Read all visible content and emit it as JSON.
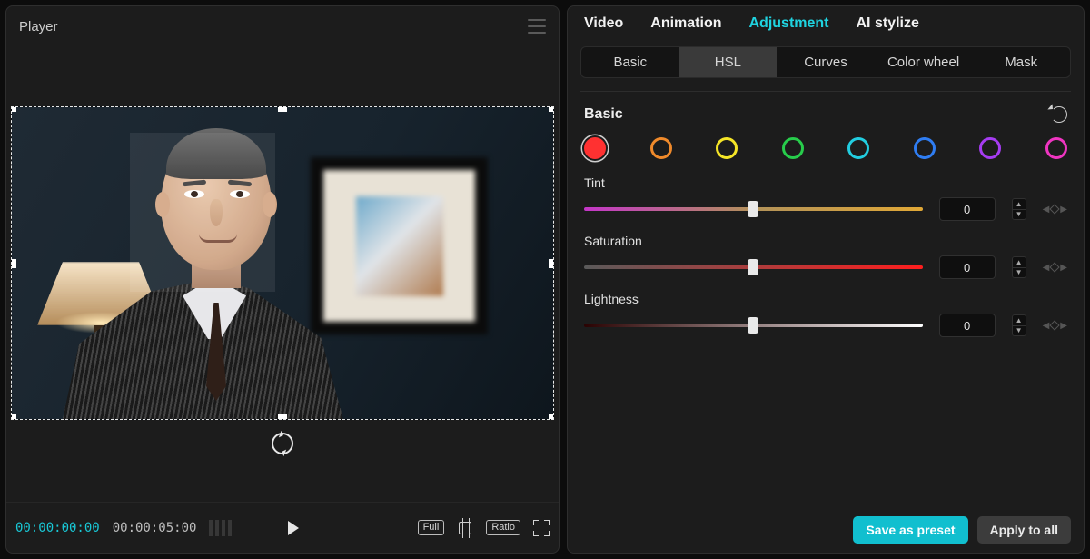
{
  "player": {
    "title": "Player",
    "current_tc": "00:00:00:00",
    "duration_tc": "00:00:05:00",
    "badges": {
      "full": "Full",
      "ratio": "Ratio"
    }
  },
  "inspector": {
    "tabs": [
      {
        "id": "video",
        "label": "Video",
        "active": false
      },
      {
        "id": "animation",
        "label": "Animation",
        "active": false
      },
      {
        "id": "adjustment",
        "label": "Adjustment",
        "active": true
      },
      {
        "id": "ai-stylize",
        "label": "AI stylize",
        "active": false
      }
    ],
    "subtabs": [
      {
        "id": "basic",
        "label": "Basic",
        "active": false
      },
      {
        "id": "hsl",
        "label": "HSL",
        "active": true
      },
      {
        "id": "curves",
        "label": "Curves",
        "active": false
      },
      {
        "id": "color-wheel",
        "label": "Color wheel",
        "active": false
      },
      {
        "id": "mask",
        "label": "Mask",
        "active": false
      }
    ],
    "section_title": "Basic",
    "swatches": [
      {
        "name": "red",
        "color": "#ff3131",
        "selected": true,
        "filled": true
      },
      {
        "name": "orange",
        "color": "#f08a2b",
        "selected": false,
        "filled": false
      },
      {
        "name": "yellow",
        "color": "#f5e527",
        "selected": false,
        "filled": false
      },
      {
        "name": "green",
        "color": "#27cc4b",
        "selected": false,
        "filled": false
      },
      {
        "name": "cyan",
        "color": "#22cde0",
        "selected": false,
        "filled": false
      },
      {
        "name": "blue",
        "color": "#2f7df2",
        "selected": false,
        "filled": false
      },
      {
        "name": "purple",
        "color": "#a63cf2",
        "selected": false,
        "filled": false
      },
      {
        "name": "magenta",
        "color": "#ef35c1",
        "selected": false,
        "filled": false
      }
    ],
    "sliders": {
      "tint": {
        "label": "Tint",
        "value": 0,
        "pos": 50
      },
      "saturation": {
        "label": "Saturation",
        "value": 0,
        "pos": 50
      },
      "lightness": {
        "label": "Lightness",
        "value": 0,
        "pos": 50
      }
    },
    "buttons": {
      "save_preset": "Save as preset",
      "apply_all": "Apply to all"
    }
  }
}
